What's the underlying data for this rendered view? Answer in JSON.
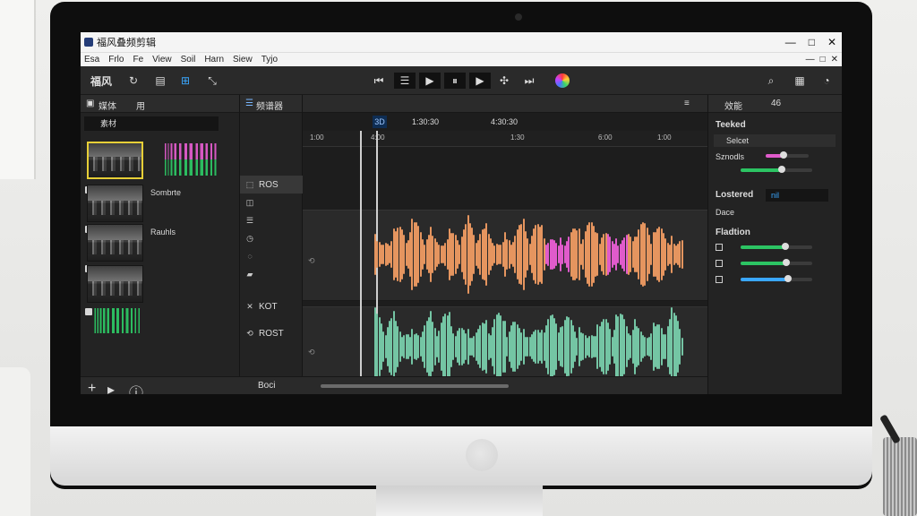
{
  "app": {
    "title": "福风叠频剪辑",
    "window_controls": [
      "—",
      "□",
      "✕"
    ]
  },
  "menu": {
    "items": [
      "Esa",
      "Frlo",
      "Fe",
      "View",
      "Soil",
      "Harn",
      "Siew",
      "Tyjo"
    ],
    "right_controls": [
      "—",
      "□",
      "✕"
    ]
  },
  "toolbar": {
    "brand": "福风",
    "left_icons": [
      "↻",
      "▤",
      "⊞",
      "⤡"
    ],
    "transport": [
      "⏮",
      "☰",
      "▶",
      "⏸",
      "▶",
      "✣",
      "⏭"
    ],
    "right_icons": [
      "⌕",
      "▦",
      "◔"
    ]
  },
  "left_panel": {
    "tab_label": "媒体",
    "tab_icon": "▣",
    "user_label": "用",
    "search_label": "素材",
    "assets": [
      {
        "label": "",
        "type": "video"
      },
      {
        "label": "Sombrte",
        "type": "video"
      },
      {
        "label": "Rauhls",
        "type": "video"
      },
      {
        "label": "",
        "type": "video"
      },
      {
        "label": "",
        "type": "audio"
      }
    ]
  },
  "tools_panel": {
    "dropdown_label": "频谱器",
    "rows": [
      {
        "label": "ROS",
        "icon": "⬚"
      },
      {
        "label": "",
        "icon": "◫"
      },
      {
        "label": "",
        "icon": "☰"
      },
      {
        "label": "",
        "icon": "◷"
      },
      {
        "label": "",
        "icon": "◌"
      },
      {
        "label": "",
        "icon": "▰"
      },
      {
        "label": "KOT",
        "icon": "✕"
      },
      {
        "label": "ROST",
        "icon": "⟲"
      }
    ],
    "bottom_label": "Boci"
  },
  "timeline": {
    "mode_label": "3D",
    "timecodes": [
      "1:30:30",
      "4:30:30"
    ],
    "ruler_labels": [
      "1:00",
      "4:00",
      "1:30",
      "6:00",
      "1:00"
    ],
    "track_labels": [
      "⟲",
      "⟲"
    ]
  },
  "right_panel": {
    "header": "效能",
    "user_label": "46",
    "sections": [
      {
        "label": "Teeked",
        "type": "heading"
      },
      {
        "label": "Selcet",
        "type": "row"
      },
      {
        "label": "Sznodls",
        "type": "row"
      },
      {
        "label": "",
        "type": "row"
      },
      {
        "label": "Lostered",
        "type": "heading"
      },
      {
        "label": "Dace",
        "type": "row"
      },
      {
        "label": "Fladtion",
        "type": "heading"
      }
    ],
    "input_value": "nil"
  },
  "colors": {
    "accent": "#3aa7ff",
    "pink": "#e05bcb",
    "green": "#2cc463",
    "orange": "#e5955f",
    "teal": "#74c5a4"
  },
  "sliders": [
    {
      "label": "Sznodls",
      "value": 0.42,
      "color": "#e05bcb"
    },
    {
      "label": "",
      "value": 0.58,
      "color": "#2cc463"
    },
    {
      "label": "Fladtion",
      "value": 0.62,
      "color": "#2cc463"
    },
    {
      "label": "",
      "value": 0.64,
      "color": "#2cc463"
    },
    {
      "label": "",
      "value": 0.66,
      "color": "#3aa7ff"
    }
  ]
}
